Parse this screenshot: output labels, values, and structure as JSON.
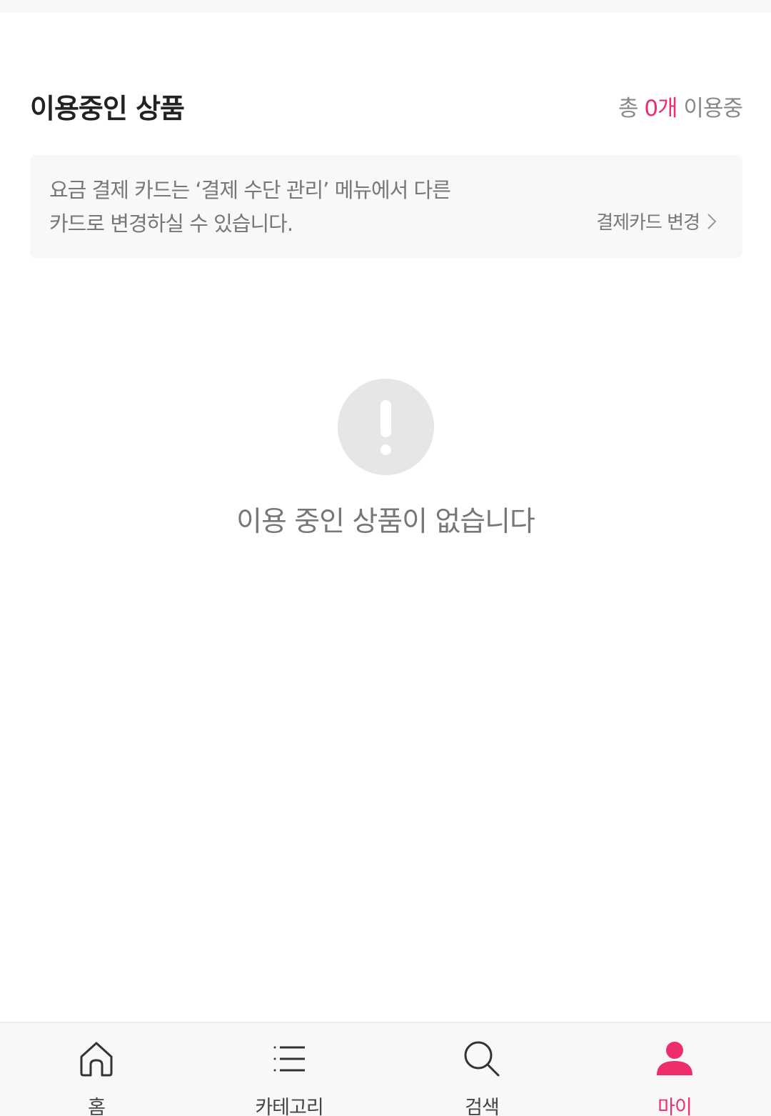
{
  "section": {
    "title": "이용중인 상품",
    "count_prefix": "총 ",
    "count_value": "0개",
    "count_suffix": " 이용중"
  },
  "info_box": {
    "line1": "요금 결제 카드는 ‘결제 수단 관리’ 메뉴에서 다른",
    "line2": "카드로 변경하실 수 있습니다.",
    "change_card_label": "결제카드 변경"
  },
  "empty_state": {
    "icon": "exclamation-circle-icon",
    "message": "이용 중인 상품이 없습니다"
  },
  "bottom_nav": {
    "items": [
      {
        "label": "홈",
        "icon": "home-icon",
        "active": false
      },
      {
        "label": "카테고리",
        "icon": "menu-list-icon",
        "active": false
      },
      {
        "label": "검색",
        "icon": "search-icon",
        "active": false
      },
      {
        "label": "마이",
        "icon": "person-icon",
        "active": true
      }
    ]
  },
  "colors": {
    "accent": "#ee2e6b",
    "text_dark": "#222222",
    "text_muted": "#777777",
    "panel_bg": "#f8f8f8",
    "alert_circle": "#e6e6e6"
  }
}
